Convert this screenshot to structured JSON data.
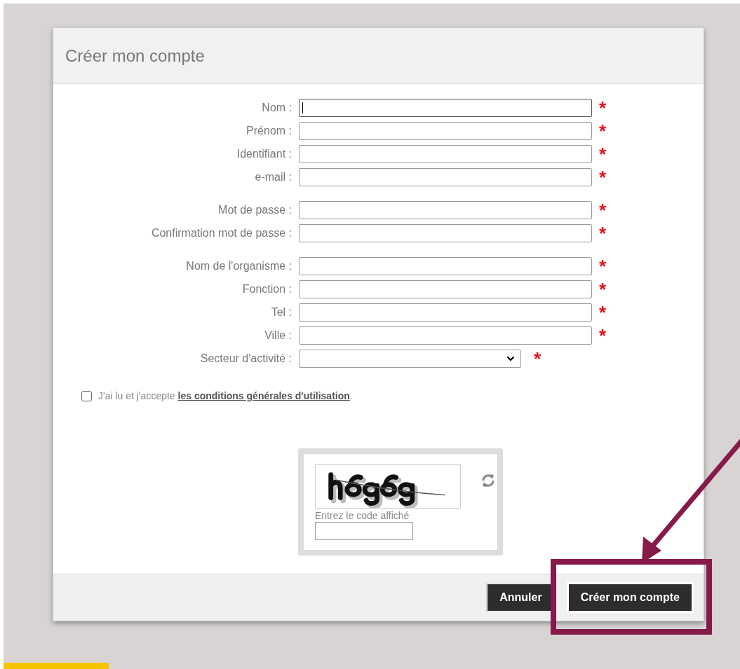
{
  "dialog": {
    "title": "Créer mon compte"
  },
  "field_groups": [
    [
      {
        "label": "Nom :",
        "kind": "text",
        "required": true,
        "focused": true
      },
      {
        "label": "Prénom :",
        "kind": "text",
        "required": true,
        "focused": false
      },
      {
        "label": "Identifiant :",
        "kind": "text",
        "required": true,
        "focused": false
      },
      {
        "label": "e-mail :",
        "kind": "text",
        "required": true,
        "focused": false
      }
    ],
    [
      {
        "label": "Mot de passe :",
        "kind": "text",
        "required": true,
        "focused": false
      },
      {
        "label": "Confirmation mot de passe :",
        "kind": "text",
        "required": true,
        "focused": false
      }
    ],
    [
      {
        "label": "Nom de l'organisme :",
        "kind": "text",
        "required": true,
        "focused": false
      },
      {
        "label": "Fonction :",
        "kind": "text",
        "required": true,
        "focused": false
      },
      {
        "label": "Tel :",
        "kind": "text",
        "required": true,
        "focused": false
      },
      {
        "label": "Ville :",
        "kind": "text",
        "required": true,
        "focused": false
      },
      {
        "label": "Secteur d'activité :",
        "kind": "select",
        "required": true,
        "focused": false
      }
    ]
  ],
  "required_mark": "*",
  "terms": {
    "checked": false,
    "text_before": "J'ai lu et j'accepte ",
    "link": "les conditions générales d'utilisation",
    "text_after": "."
  },
  "captcha": {
    "prompt": "Entrez le code affiché"
  },
  "buttons": [
    {
      "label": "Annuler",
      "highlighted": false
    },
    {
      "label": "Créer mon compte",
      "highlighted": true
    }
  ]
}
